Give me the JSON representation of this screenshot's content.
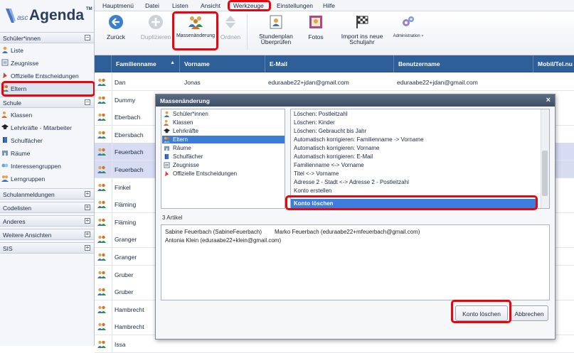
{
  "app": {
    "logo_prefix": "asc",
    "logo_name": "Agenda",
    "logo_tm": "TM"
  },
  "menubar": [
    "Hauptmenü",
    "Datei",
    "Listen",
    "Ansicht",
    "Werkzeuge",
    "Einstellungen",
    "Hilfe"
  ],
  "toolbar": {
    "back": "Zurück",
    "duplicate": "Duplizieren",
    "mass_change": "Massenänderung",
    "order": "Ordnen",
    "timetable_line1": "Stundenplan",
    "timetable_line2": "Überprüfen",
    "photos": "Fotos",
    "import_line1": "Import ins neue",
    "import_line2": "Schuljahr",
    "administration": "Administration"
  },
  "sidebar": {
    "sections": [
      {
        "title": "Schüler*innen",
        "expanded": true,
        "items": [
          "Liste",
          "Zeugnisse",
          "Offizielle Entscheidungen",
          "Eltern"
        ]
      },
      {
        "title": "Schule",
        "expanded": true,
        "items": [
          "Klassen",
          "Lehrkräfte - Mitarbeiter",
          "Schulfächer",
          "Räume",
          "Interessengruppen",
          "Lerngruppen"
        ]
      },
      {
        "title": "Schulanmeldungen",
        "expanded": false
      },
      {
        "title": "Codelisten",
        "expanded": false
      },
      {
        "title": "Anderes",
        "expanded": false
      },
      {
        "title": "Weitere Ansichten",
        "expanded": false
      },
      {
        "title": "SIS",
        "expanded": false
      }
    ],
    "selected_item": "Eltern"
  },
  "grid": {
    "columns": [
      "Familienname",
      "Vorname",
      "E-Mail",
      "Benutzername",
      "Mobil/Tel.nu"
    ],
    "rows": [
      {
        "last": "Dan",
        "first": "Jonas",
        "email": "eduraabe22+jdan@gmail.com",
        "user": "eduraabe22+jdan@gmail.com",
        "selected": false
      },
      {
        "last": "Dummy",
        "first": "",
        "email": "",
        "user": "",
        "selected": false
      },
      {
        "last": "Eberbach",
        "first": "",
        "email": "",
        "user": "",
        "selected": false
      },
      {
        "last": "Ebersbach",
        "first": "",
        "email": "",
        "user": "",
        "selected": false
      },
      {
        "last": "Feuerbach",
        "first": "",
        "email": "",
        "user": "",
        "selected": true
      },
      {
        "last": "Feuerbach",
        "first": "",
        "email": "",
        "user": "",
        "selected": true
      },
      {
        "last": "Finkel",
        "first": "",
        "email": "",
        "user": "",
        "selected": false
      },
      {
        "last": "Fläming",
        "first": "",
        "email": "",
        "user": "",
        "selected": false
      },
      {
        "last": "Fläming",
        "first": "",
        "email": "",
        "user": "",
        "selected": false
      },
      {
        "last": "Granger",
        "first": "",
        "email": "",
        "user": "",
        "selected": false
      },
      {
        "last": "Granger",
        "first": "",
        "email": "",
        "user": "",
        "selected": false
      },
      {
        "last": "Gruber",
        "first": "",
        "email": "",
        "user": "",
        "selected": false
      },
      {
        "last": "Gruber",
        "first": "",
        "email": "",
        "user": "",
        "selected": false
      },
      {
        "last": "Hambrecht",
        "first": "",
        "email": "",
        "user": "",
        "selected": false
      },
      {
        "last": "Hambrecht",
        "first": "",
        "email": "",
        "user": "",
        "selected": false
      },
      {
        "last": "Issa",
        "first": "",
        "email": "",
        "user": "",
        "selected": false
      }
    ]
  },
  "dialog": {
    "title": "Massenänderung",
    "close": "×",
    "categories": [
      "Schüler*innen",
      "Klassen",
      "Lehrkräfte",
      "Eltern",
      "Räume",
      "Schulfächer",
      "Zeugnisse",
      "Offizielle Entscheidungen"
    ],
    "selected_category": "Eltern",
    "actions": [
      "Löschen: Postleitzahl",
      "Löschen: Kinder",
      "Löschen: Gebraucht bis Jahr",
      "Automatisch korrigieren: Familienname -> Vorname",
      "Automatisch korrigieren: Vorname",
      "Automatisch korrigieren: E-Mail",
      "Familienname <-> Vorname",
      "Titel <-> Vorname",
      "Adresse 2 - Stadt <-> Adresse 2 - Postleitzahl",
      "Konto erstellen"
    ],
    "selected_action": "Konto löschen",
    "article_count": "3 Artikel",
    "articles": [
      {
        "name": "Sabine Feuerbach (SabineFeuerbach)",
        "detail": "Marko Feuerbach (eduraabe22+mfeuerbach@gmail.com)"
      },
      {
        "name": "Antonia Klein (eduraabe22+klein@gmail.com)",
        "detail": ""
      }
    ],
    "confirm_button": "Konto löschen",
    "cancel_button": "Abbrechen"
  },
  "colors": {
    "grid_header": "#2f5f98",
    "selection": "#3b7ee0",
    "highlight_box": "#e4070f",
    "row_selected": "#d7dcf2"
  }
}
